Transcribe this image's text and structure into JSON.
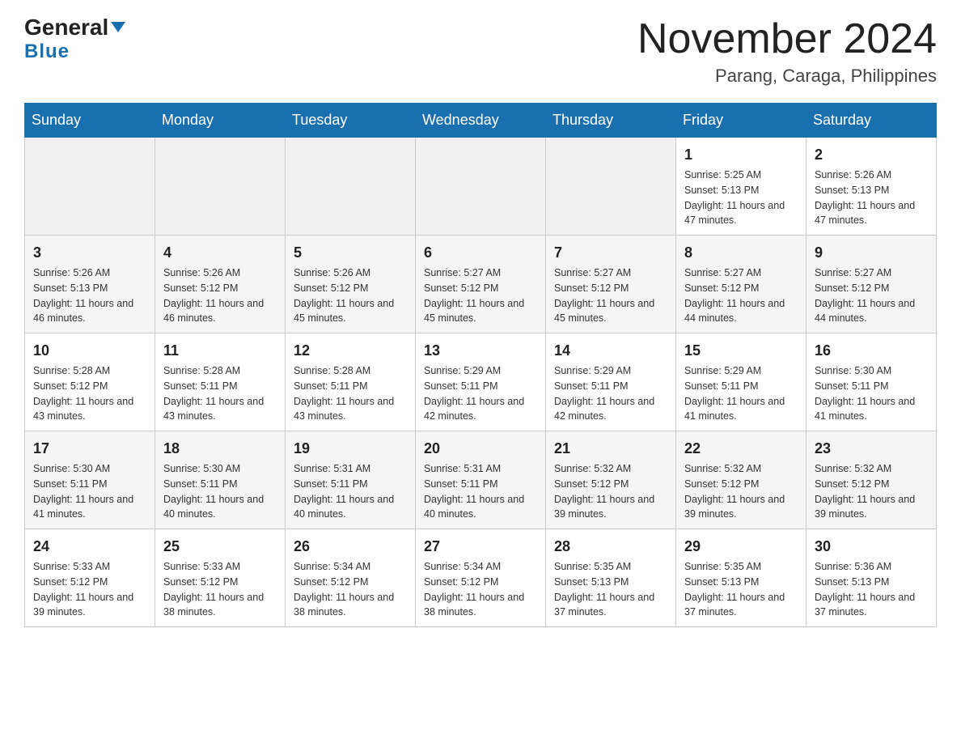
{
  "header": {
    "logo_general": "General",
    "logo_blue": "Blue",
    "month_title": "November 2024",
    "location": "Parang, Caraga, Philippines"
  },
  "calendar": {
    "days_of_week": [
      "Sunday",
      "Monday",
      "Tuesday",
      "Wednesday",
      "Thursday",
      "Friday",
      "Saturday"
    ],
    "weeks": [
      [
        {
          "day": "",
          "info": ""
        },
        {
          "day": "",
          "info": ""
        },
        {
          "day": "",
          "info": ""
        },
        {
          "day": "",
          "info": ""
        },
        {
          "day": "",
          "info": ""
        },
        {
          "day": "1",
          "info": "Sunrise: 5:25 AM\nSunset: 5:13 PM\nDaylight: 11 hours and 47 minutes."
        },
        {
          "day": "2",
          "info": "Sunrise: 5:26 AM\nSunset: 5:13 PM\nDaylight: 11 hours and 47 minutes."
        }
      ],
      [
        {
          "day": "3",
          "info": "Sunrise: 5:26 AM\nSunset: 5:13 PM\nDaylight: 11 hours and 46 minutes."
        },
        {
          "day": "4",
          "info": "Sunrise: 5:26 AM\nSunset: 5:12 PM\nDaylight: 11 hours and 46 minutes."
        },
        {
          "day": "5",
          "info": "Sunrise: 5:26 AM\nSunset: 5:12 PM\nDaylight: 11 hours and 45 minutes."
        },
        {
          "day": "6",
          "info": "Sunrise: 5:27 AM\nSunset: 5:12 PM\nDaylight: 11 hours and 45 minutes."
        },
        {
          "day": "7",
          "info": "Sunrise: 5:27 AM\nSunset: 5:12 PM\nDaylight: 11 hours and 45 minutes."
        },
        {
          "day": "8",
          "info": "Sunrise: 5:27 AM\nSunset: 5:12 PM\nDaylight: 11 hours and 44 minutes."
        },
        {
          "day": "9",
          "info": "Sunrise: 5:27 AM\nSunset: 5:12 PM\nDaylight: 11 hours and 44 minutes."
        }
      ],
      [
        {
          "day": "10",
          "info": "Sunrise: 5:28 AM\nSunset: 5:12 PM\nDaylight: 11 hours and 43 minutes."
        },
        {
          "day": "11",
          "info": "Sunrise: 5:28 AM\nSunset: 5:11 PM\nDaylight: 11 hours and 43 minutes."
        },
        {
          "day": "12",
          "info": "Sunrise: 5:28 AM\nSunset: 5:11 PM\nDaylight: 11 hours and 43 minutes."
        },
        {
          "day": "13",
          "info": "Sunrise: 5:29 AM\nSunset: 5:11 PM\nDaylight: 11 hours and 42 minutes."
        },
        {
          "day": "14",
          "info": "Sunrise: 5:29 AM\nSunset: 5:11 PM\nDaylight: 11 hours and 42 minutes."
        },
        {
          "day": "15",
          "info": "Sunrise: 5:29 AM\nSunset: 5:11 PM\nDaylight: 11 hours and 41 minutes."
        },
        {
          "day": "16",
          "info": "Sunrise: 5:30 AM\nSunset: 5:11 PM\nDaylight: 11 hours and 41 minutes."
        }
      ],
      [
        {
          "day": "17",
          "info": "Sunrise: 5:30 AM\nSunset: 5:11 PM\nDaylight: 11 hours and 41 minutes."
        },
        {
          "day": "18",
          "info": "Sunrise: 5:30 AM\nSunset: 5:11 PM\nDaylight: 11 hours and 40 minutes."
        },
        {
          "day": "19",
          "info": "Sunrise: 5:31 AM\nSunset: 5:11 PM\nDaylight: 11 hours and 40 minutes."
        },
        {
          "day": "20",
          "info": "Sunrise: 5:31 AM\nSunset: 5:11 PM\nDaylight: 11 hours and 40 minutes."
        },
        {
          "day": "21",
          "info": "Sunrise: 5:32 AM\nSunset: 5:12 PM\nDaylight: 11 hours and 39 minutes."
        },
        {
          "day": "22",
          "info": "Sunrise: 5:32 AM\nSunset: 5:12 PM\nDaylight: 11 hours and 39 minutes."
        },
        {
          "day": "23",
          "info": "Sunrise: 5:32 AM\nSunset: 5:12 PM\nDaylight: 11 hours and 39 minutes."
        }
      ],
      [
        {
          "day": "24",
          "info": "Sunrise: 5:33 AM\nSunset: 5:12 PM\nDaylight: 11 hours and 39 minutes."
        },
        {
          "day": "25",
          "info": "Sunrise: 5:33 AM\nSunset: 5:12 PM\nDaylight: 11 hours and 38 minutes."
        },
        {
          "day": "26",
          "info": "Sunrise: 5:34 AM\nSunset: 5:12 PM\nDaylight: 11 hours and 38 minutes."
        },
        {
          "day": "27",
          "info": "Sunrise: 5:34 AM\nSunset: 5:12 PM\nDaylight: 11 hours and 38 minutes."
        },
        {
          "day": "28",
          "info": "Sunrise: 5:35 AM\nSunset: 5:13 PM\nDaylight: 11 hours and 37 minutes."
        },
        {
          "day": "29",
          "info": "Sunrise: 5:35 AM\nSunset: 5:13 PM\nDaylight: 11 hours and 37 minutes."
        },
        {
          "day": "30",
          "info": "Sunrise: 5:36 AM\nSunset: 5:13 PM\nDaylight: 11 hours and 37 minutes."
        }
      ]
    ]
  }
}
